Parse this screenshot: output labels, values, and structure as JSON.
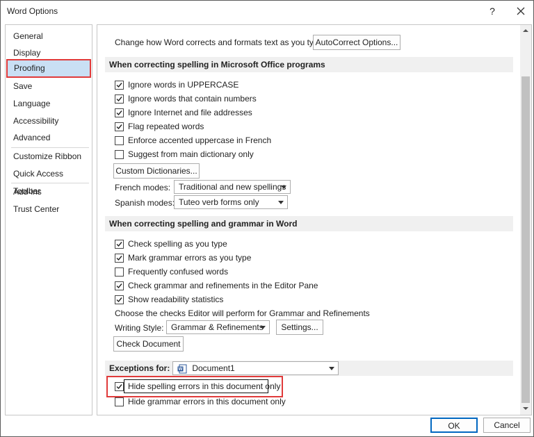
{
  "window": {
    "title": "Word Options",
    "help_symbol": "?"
  },
  "nav": {
    "items": [
      {
        "label": "General"
      },
      {
        "label": "Display"
      },
      {
        "label": "Proofing"
      },
      {
        "label": "Save"
      },
      {
        "label": "Language"
      },
      {
        "label": "Accessibility"
      },
      {
        "label": "Advanced"
      },
      {
        "label": "Customize Ribbon"
      },
      {
        "label": "Quick Access Toolbar"
      },
      {
        "label": "Add-ins"
      },
      {
        "label": "Trust Center"
      }
    ],
    "selected": "Proofing"
  },
  "autocorrect": {
    "text": "Change how Word corrects and formats text as you type:",
    "button": "AutoCorrect Options..."
  },
  "office_spelling": {
    "header": "When correcting spelling in Microsoft Office programs",
    "options": [
      {
        "label": "Ignore words in UPPERCASE",
        "checked": true
      },
      {
        "label": "Ignore words that contain numbers",
        "checked": true
      },
      {
        "label": "Ignore Internet and file addresses",
        "checked": true
      },
      {
        "label": "Flag repeated words",
        "checked": true
      },
      {
        "label": "Enforce accented uppercase in French",
        "checked": false
      },
      {
        "label": "Suggest from main dictionary only",
        "checked": false
      }
    ],
    "custom_dictionaries_button": "Custom Dictionaries...",
    "french_modes_label": "French modes:",
    "french_modes_value": "Traditional and new spellings",
    "spanish_modes_label": "Spanish modes:",
    "spanish_modes_value": "Tuteo verb forms only"
  },
  "word_spelling": {
    "header": "When correcting spelling and grammar in Word",
    "options": [
      {
        "label": "Check spelling as you type",
        "checked": true
      },
      {
        "label": "Mark grammar errors as you type",
        "checked": true
      },
      {
        "label": "Frequently confused words",
        "checked": false
      },
      {
        "label": "Check grammar and refinements in the Editor Pane",
        "checked": true
      },
      {
        "label": "Show readability statistics",
        "checked": true
      }
    ],
    "editor_text": "Choose the checks Editor will perform for Grammar and Refinements",
    "writing_style_label": "Writing Style:",
    "writing_style_value": "Grammar & Refinements",
    "settings_button": "Settings...",
    "check_document_button": "Check Document"
  },
  "exceptions": {
    "label": "Exceptions for:",
    "document": "Document1",
    "options": [
      {
        "label": "Hide spelling errors in this document only",
        "checked": true
      },
      {
        "label": "Hide grammar errors in this document only",
        "checked": false
      }
    ]
  },
  "footer": {
    "ok": "OK",
    "cancel": "Cancel"
  },
  "colors": {
    "highlight_red": "#e03a3a",
    "selected_nav": "#c9dff4",
    "ok_border": "#0067c0"
  }
}
